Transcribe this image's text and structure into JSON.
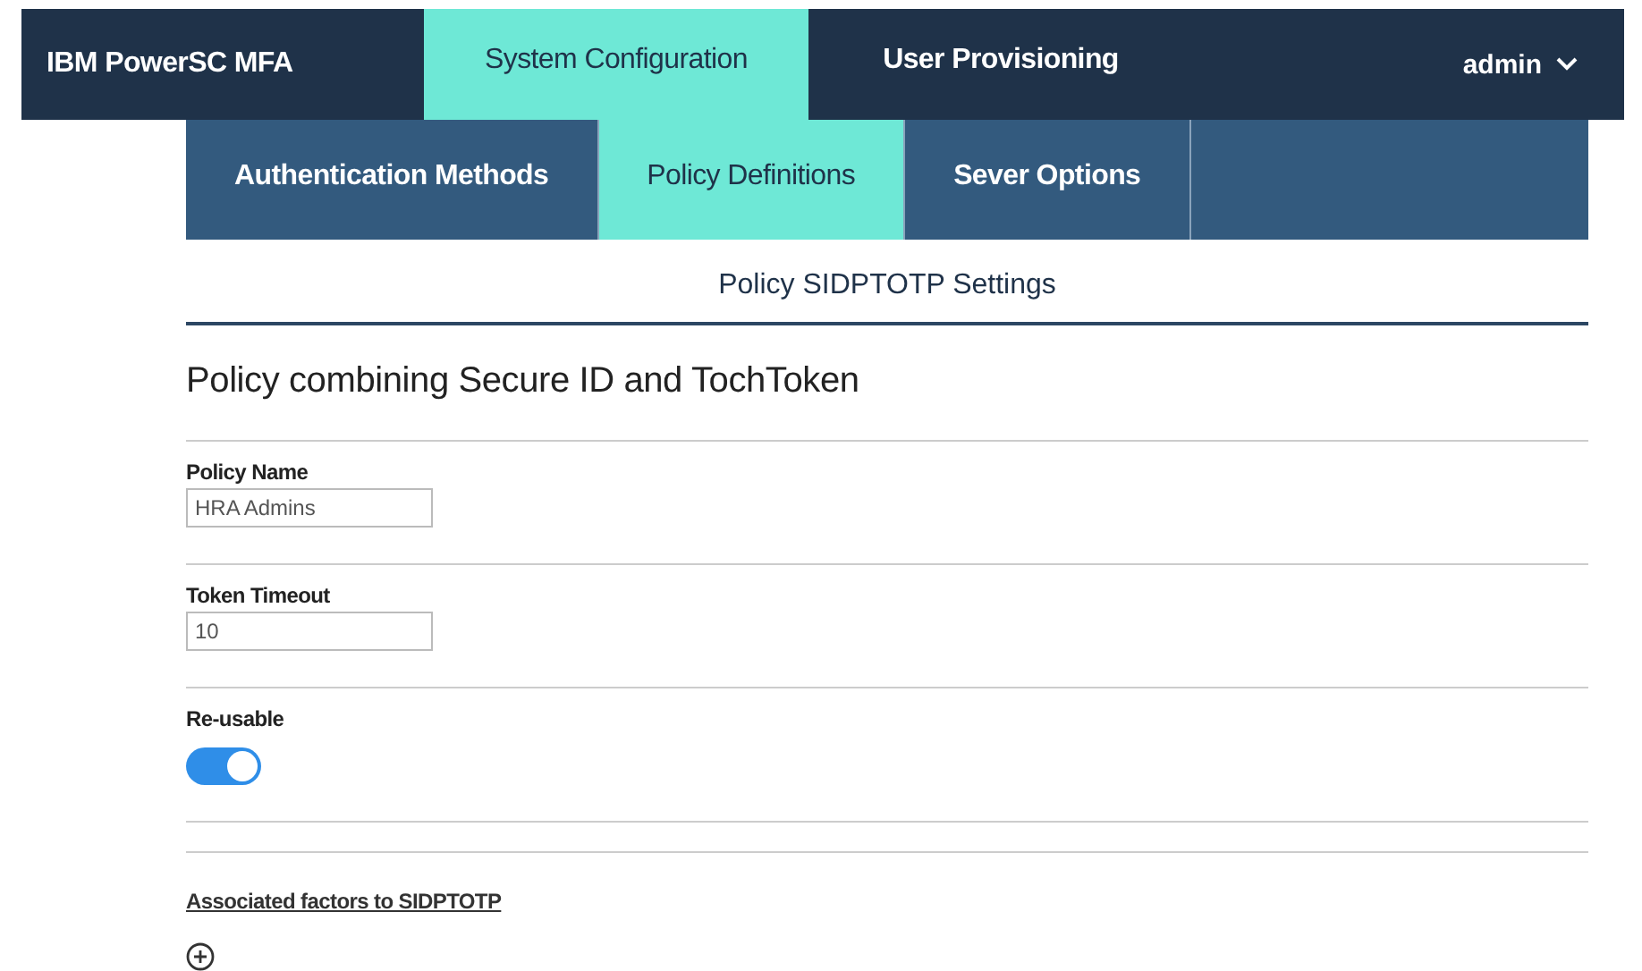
{
  "brand": "IBM PowerSC MFA",
  "top_tabs": [
    {
      "label": "System Configuration",
      "selected": true
    },
    {
      "label": "User Provisioning",
      "selected": false
    }
  ],
  "user_menu": {
    "label": "admin"
  },
  "sub_tabs": [
    {
      "label": "Authentication Methods",
      "selected": false
    },
    {
      "label": "Policy Definitions",
      "selected": true
    },
    {
      "label": "Sever Options",
      "selected": false
    }
  ],
  "section_title": "Policy SIDPTOTP Settings",
  "policy_title": "Policy combining Secure ID and TochToken",
  "fields": [
    {
      "kind": "text",
      "label": "Policy Name",
      "value": "HRA Admins"
    },
    {
      "kind": "text",
      "label": "Token Timeout",
      "value": "10"
    },
    {
      "kind": "toggle",
      "label": "Re-usable",
      "on": true
    }
  ],
  "associated_link": "Associated factors to SIDPTOTP"
}
